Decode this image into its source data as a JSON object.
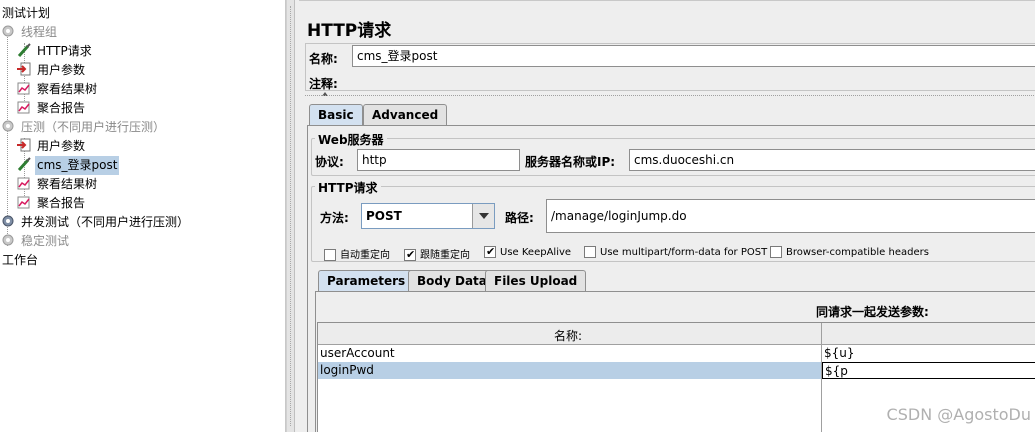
{
  "tree": {
    "items": [
      {
        "label": "测试计划",
        "icon": "test-plan-icon",
        "disabled": false,
        "selected": false
      },
      {
        "label": "线程组",
        "icon": "gear-icon",
        "disabled": true,
        "selected": false
      },
      {
        "label": "HTTP请求",
        "icon": "pipette-icon",
        "disabled": false,
        "selected": false
      },
      {
        "label": "用户参数",
        "icon": "preprocessor-icon",
        "disabled": false,
        "selected": false
      },
      {
        "label": "察看结果树",
        "icon": "chart-icon",
        "disabled": false,
        "selected": false
      },
      {
        "label": "聚合报告",
        "icon": "chart-icon",
        "disabled": false,
        "selected": false
      },
      {
        "label": "压测（不同用户进行压测）",
        "icon": "gear-icon",
        "disabled": true,
        "selected": false
      },
      {
        "label": "用户参数",
        "icon": "preprocessor-icon",
        "disabled": false,
        "selected": false
      },
      {
        "label": "cms_登录post",
        "icon": "pipette-icon",
        "disabled": false,
        "selected": true
      },
      {
        "label": "察看结果树",
        "icon": "chart-icon",
        "disabled": false,
        "selected": false
      },
      {
        "label": "聚合报告",
        "icon": "chart-icon",
        "disabled": false,
        "selected": false
      },
      {
        "label": "并发测试（不同用户进行压测）",
        "icon": "gear-icon",
        "disabled": false,
        "selected": false
      },
      {
        "label": "稳定测试",
        "icon": "gear-icon",
        "disabled": true,
        "selected": false
      },
      {
        "label": "工作台",
        "icon": "workbench-icon",
        "disabled": false,
        "selected": false
      }
    ]
  },
  "panel": {
    "title": "HTTP请求",
    "name_label": "名称:",
    "name_value": "cms_登录post",
    "comment_label": "注释:",
    "tabs": [
      "Basic",
      "Advanced"
    ],
    "web_server": {
      "legend": "Web服务器",
      "protocol_label": "协议:",
      "protocol_value": "http",
      "server_label": "服务器名称或IP:",
      "server_value": "cms.duoceshi.cn"
    },
    "http_request": {
      "legend": "HTTP请求",
      "method_label": "方法:",
      "method_value": "POST",
      "path_label": "路径:",
      "path_value": "/manage/loginJump.do"
    },
    "checkboxes": [
      {
        "label": "自动重定向",
        "checked": false
      },
      {
        "label": "跟随重定向",
        "checked": true
      },
      {
        "label": "Use KeepAlive",
        "checked": true
      },
      {
        "label": "Use multipart/form-data for POST",
        "checked": false
      },
      {
        "label": "Browser-compatible headers",
        "checked": false
      }
    ],
    "param_tabs": [
      "Parameters",
      "Body Data",
      "Files Upload"
    ],
    "params": {
      "section_title": "同请求一起发送参数:",
      "col_name": "名称:",
      "rows": [
        {
          "name": "userAccount",
          "value": "${u}",
          "selected": false
        },
        {
          "name": "loginPwd",
          "value": "${p",
          "selected": true
        }
      ]
    }
  },
  "watermark": "CSDN @AgostoDu",
  "colors": {
    "selection": "#b8cfe5",
    "active_tab": "#d3e1f0",
    "background": "#eeeeee"
  }
}
